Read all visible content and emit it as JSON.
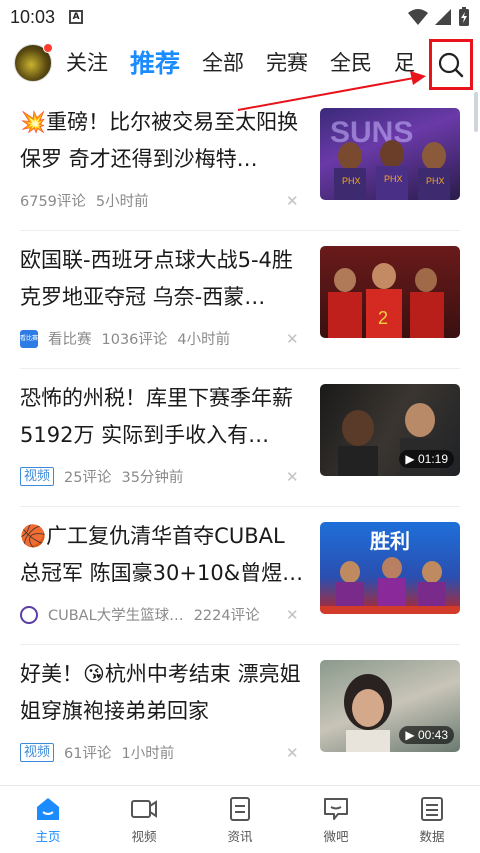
{
  "status": {
    "time": "10:03",
    "sim_label": "A"
  },
  "header": {
    "tabs": [
      {
        "label": "关注"
      },
      {
        "label": "推荐"
      },
      {
        "label": "全部"
      },
      {
        "label": "完赛"
      },
      {
        "label": "全民"
      },
      {
        "label": "足"
      }
    ],
    "active_tab": "推荐",
    "search_icon": "search-icon"
  },
  "feed": [
    {
      "emoji": "💥",
      "title": "重磅！比尔被交易至太阳换保罗 奇才还得到沙梅特…",
      "comments": "6759评论",
      "time": "5小时前",
      "thumb_text": "SUNS"
    },
    {
      "title": "欧国联-西班牙点球大战5-4胜克罗地亚夺冠 乌奈-西蒙…",
      "source": "看比赛",
      "source_icon_text": "看比赛",
      "comments": "1036评论",
      "time": "4小时前"
    },
    {
      "title": "恐怖的州税！库里下赛季年薪5192万 实际到手收入有…",
      "tag": "视频",
      "comments": "25评论",
      "time": "35分钟前",
      "duration": "01:19"
    },
    {
      "emoji": "🏀",
      "title": "广工复仇清华首夺CUBAL总冠军 陈国豪30+10&曾煜…",
      "source": "CUBAL大学生篮球…",
      "comments": "2224评论",
      "thumb_text": "胜利"
    },
    {
      "title": "好美！😘杭州中考结束 漂亮姐姐穿旗袍接弟弟回家",
      "tag": "视频",
      "comments": "61评论",
      "time": "1小时前",
      "duration": "00:43"
    }
  ],
  "bottom_nav": [
    {
      "label": "主页",
      "icon": "home-icon"
    },
    {
      "label": "视频",
      "icon": "video-icon"
    },
    {
      "label": "资讯",
      "icon": "news-icon"
    },
    {
      "label": "微吧",
      "icon": "chat-icon"
    },
    {
      "label": "数据",
      "icon": "data-icon"
    }
  ],
  "colors": {
    "accent": "#1a8cff",
    "highlight_box": "#e8131b"
  }
}
